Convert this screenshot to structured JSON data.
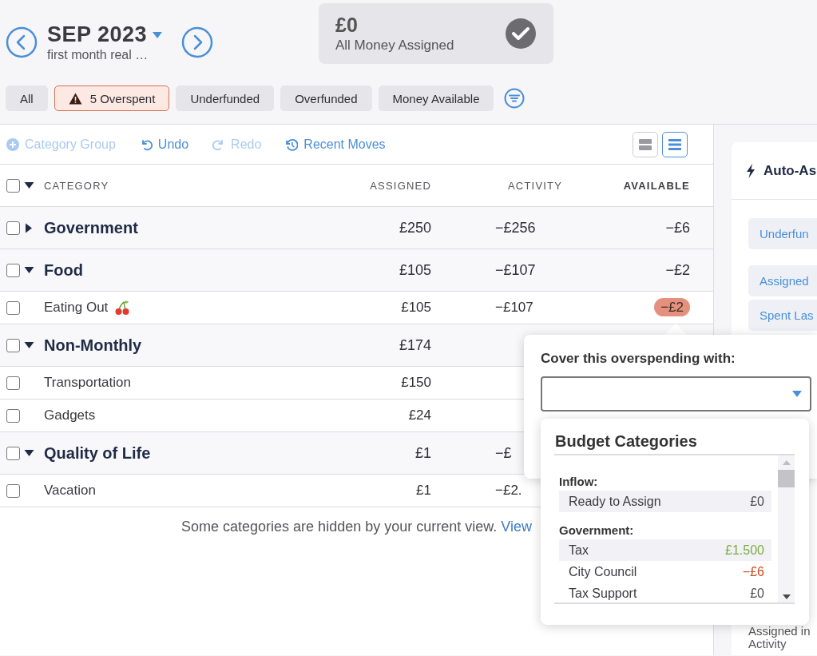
{
  "header": {
    "month": "SEP 2023",
    "note": "first month real …"
  },
  "summary": {
    "amount": "£0",
    "label": "All Money Assigned"
  },
  "filters": [
    {
      "label": "All",
      "selected": false
    },
    {
      "label": "5 Overspent",
      "selected": true,
      "kind": "warning"
    },
    {
      "label": "Underfunded",
      "selected": false
    },
    {
      "label": "Overfunded",
      "selected": false
    },
    {
      "label": "Money Available",
      "selected": false
    }
  ],
  "toolbar": {
    "actions": [
      {
        "label": "Category Group",
        "kind": "add",
        "disabled": true
      },
      {
        "label": "Undo",
        "kind": "undo",
        "disabled": false
      },
      {
        "label": "Redo",
        "kind": "redo",
        "disabled": true
      },
      {
        "label": "Recent Moves",
        "kind": "history",
        "disabled": false
      }
    ],
    "views": [
      {
        "kind": "expanded",
        "selected": false
      },
      {
        "kind": "compact",
        "selected": true
      }
    ]
  },
  "table": {
    "checked": false,
    "expanded": true,
    "columns": [
      {
        "label": "CATEGORY",
        "selected": false
      },
      {
        "label": "ASSIGNED",
        "selected": false
      },
      {
        "label": "ACTIVITY",
        "selected": false
      },
      {
        "label": "AVAILABLE",
        "selected": true
      }
    ],
    "rows": [
      {
        "kind": "group",
        "name": "Government",
        "checked": false,
        "expanded": false,
        "assigned": "£250",
        "activity": "−£256",
        "available": "−£6",
        "overspent": false
      },
      {
        "kind": "group",
        "name": "Food",
        "checked": false,
        "expanded": true,
        "assigned": "£105",
        "activity": "−£107",
        "available": "−£2",
        "overspent": false
      },
      {
        "kind": "cherry",
        "name": "Eating Out",
        "checked": false,
        "assigned": "£105",
        "activity": "−£107",
        "available": "−£2",
        "overspent": true
      },
      {
        "kind": "group",
        "name": "Non-Monthly",
        "checked": false,
        "expanded": true,
        "assigned": "£174"
      },
      {
        "kind": "category",
        "name": "Transportation",
        "checked": false,
        "assigned": "£150"
      },
      {
        "kind": "category",
        "name": "Gadgets",
        "checked": false,
        "assigned": "£24"
      },
      {
        "kind": "group",
        "name": "Quality of Life",
        "checked": false,
        "expanded": true,
        "assigned": "£1",
        "activity": "−£"
      },
      {
        "kind": "category",
        "name": "Vacation",
        "checked": false,
        "assigned": "£1",
        "activity": "−£2."
      }
    ]
  },
  "footer": {
    "text": "Some categories are hidden by your current view.",
    "link": "View"
  },
  "side_panel": {
    "title": "Auto-As",
    "buttons": [
      "Underfun",
      "Assigned",
      "Spent Las"
    ],
    "lines": [
      "Assigned in",
      "Activity"
    ]
  },
  "popover": {
    "label": "Cover this overspending with:",
    "dropdown": {
      "title": "Budget Categories",
      "groups": [
        {
          "name": "Inflow:",
          "items": [
            {
              "name": "Ready to Assign",
              "amount": "£0",
              "highlighted": true,
              "color": "#4d4d4d"
            }
          ]
        },
        {
          "name": "Government:",
          "items": [
            {
              "name": "Tax",
              "amount": "£1.500",
              "highlighted": true,
              "color": "#7aab3e"
            },
            {
              "name": "City Council",
              "amount": "−£6",
              "highlighted": false,
              "color": "#cc4b1f"
            },
            {
              "name": "Tax Support",
              "amount": "£0",
              "highlighted": false,
              "color": "#4d4d4d"
            }
          ]
        }
      ]
    }
  }
}
